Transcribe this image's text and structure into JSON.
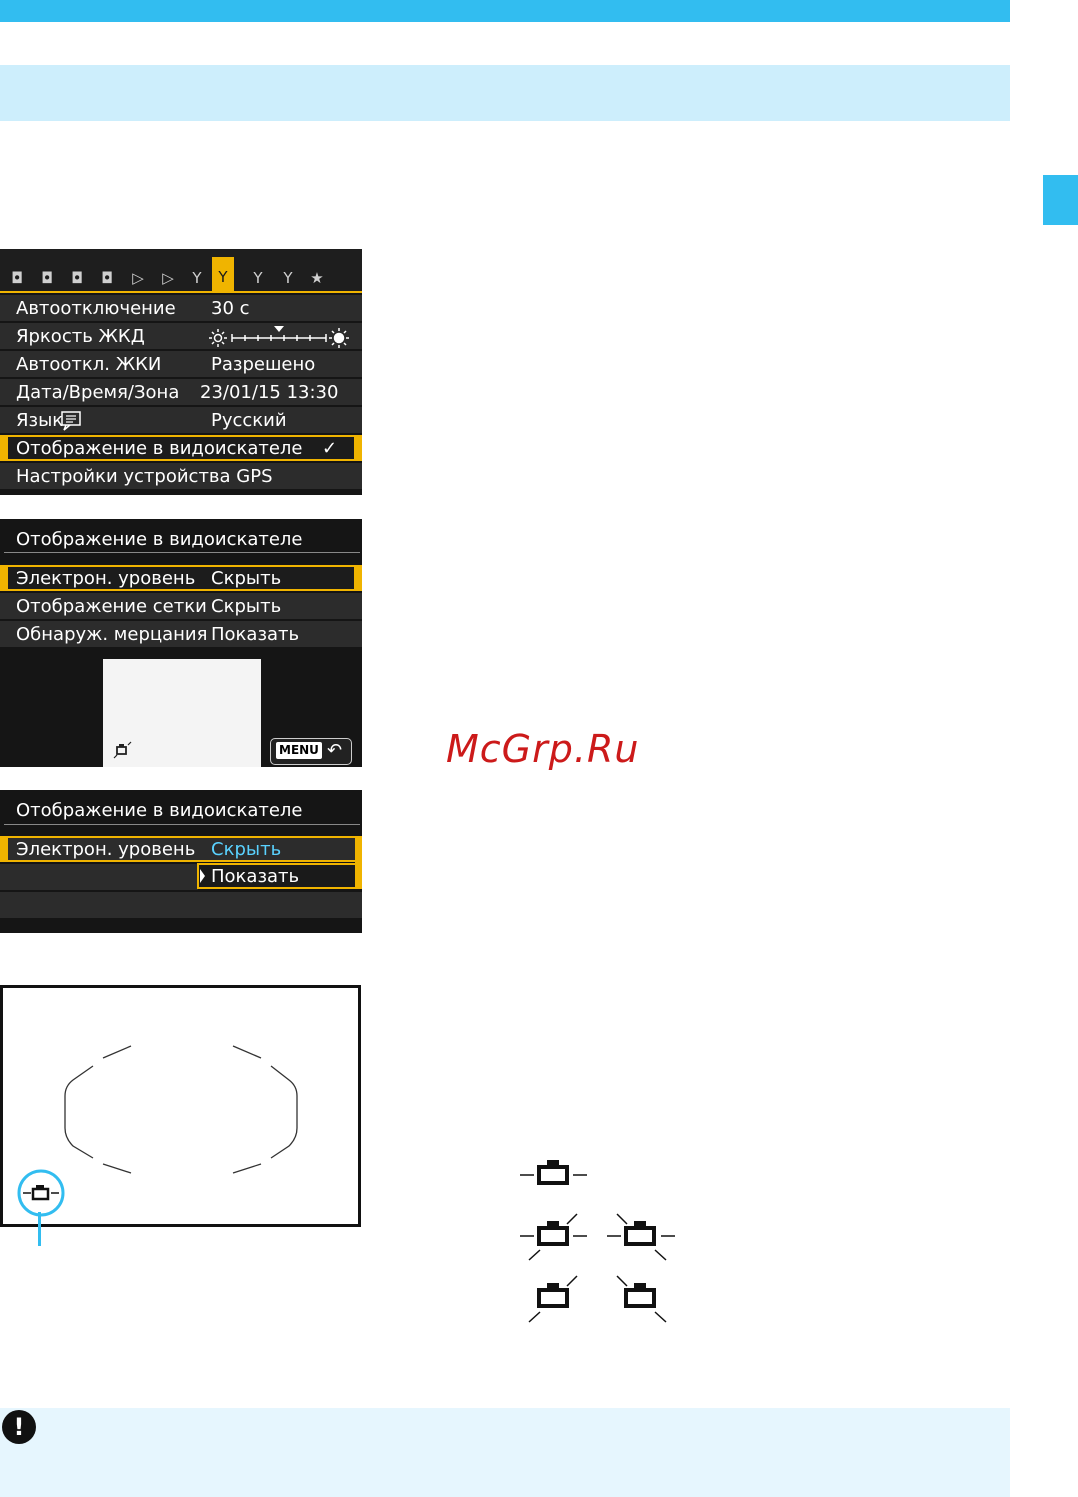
{
  "menu1": {
    "tabs": [
      "camera-1",
      "camera-2",
      "camera-3",
      "camera-4",
      "play-1",
      "play-2",
      "setup-1",
      "setup-2",
      "setup-3",
      "setup-4",
      "my-menu"
    ],
    "active_tab": "setup-2",
    "rows": [
      {
        "label": "Автоотключение",
        "value": "30 с"
      },
      {
        "label": "Яркость ЖКД",
        "value": ""
      },
      {
        "label": "Автооткл. ЖКИ",
        "value": "Разрешено"
      },
      {
        "label": "Дата/Время/Зона",
        "value": "23/01/15 13:30"
      },
      {
        "label": "Язык",
        "value": "Русский"
      },
      {
        "label": "Отображение в видоискателе",
        "value": "✓"
      },
      {
        "label": "Настройки устройства GPS",
        "value": ""
      }
    ],
    "brightness_level": 0.55
  },
  "menu2": {
    "title": "Отображение в видоискателе",
    "rows": [
      {
        "label": "Электрон. уровень",
        "value": "Скрыть"
      },
      {
        "label": "Отображение сетки",
        "value": "Скрыть"
      },
      {
        "label": "Обнаруж. мерцания",
        "value": "Показать"
      }
    ],
    "menu_button": "MENU",
    "back_symbol": "↶"
  },
  "menu3": {
    "title": "Отображение в видоискателе",
    "row_label": "Электрон. уровень",
    "options": [
      "Скрыть",
      "Показать"
    ],
    "selected": "Показать"
  },
  "watermark": "McGrp.Ru",
  "colors": {
    "accent": "#32bdf0",
    "highlight": "#f0b400",
    "option_blue": "#5ad2ff",
    "watermark": "#cc1a1a"
  }
}
